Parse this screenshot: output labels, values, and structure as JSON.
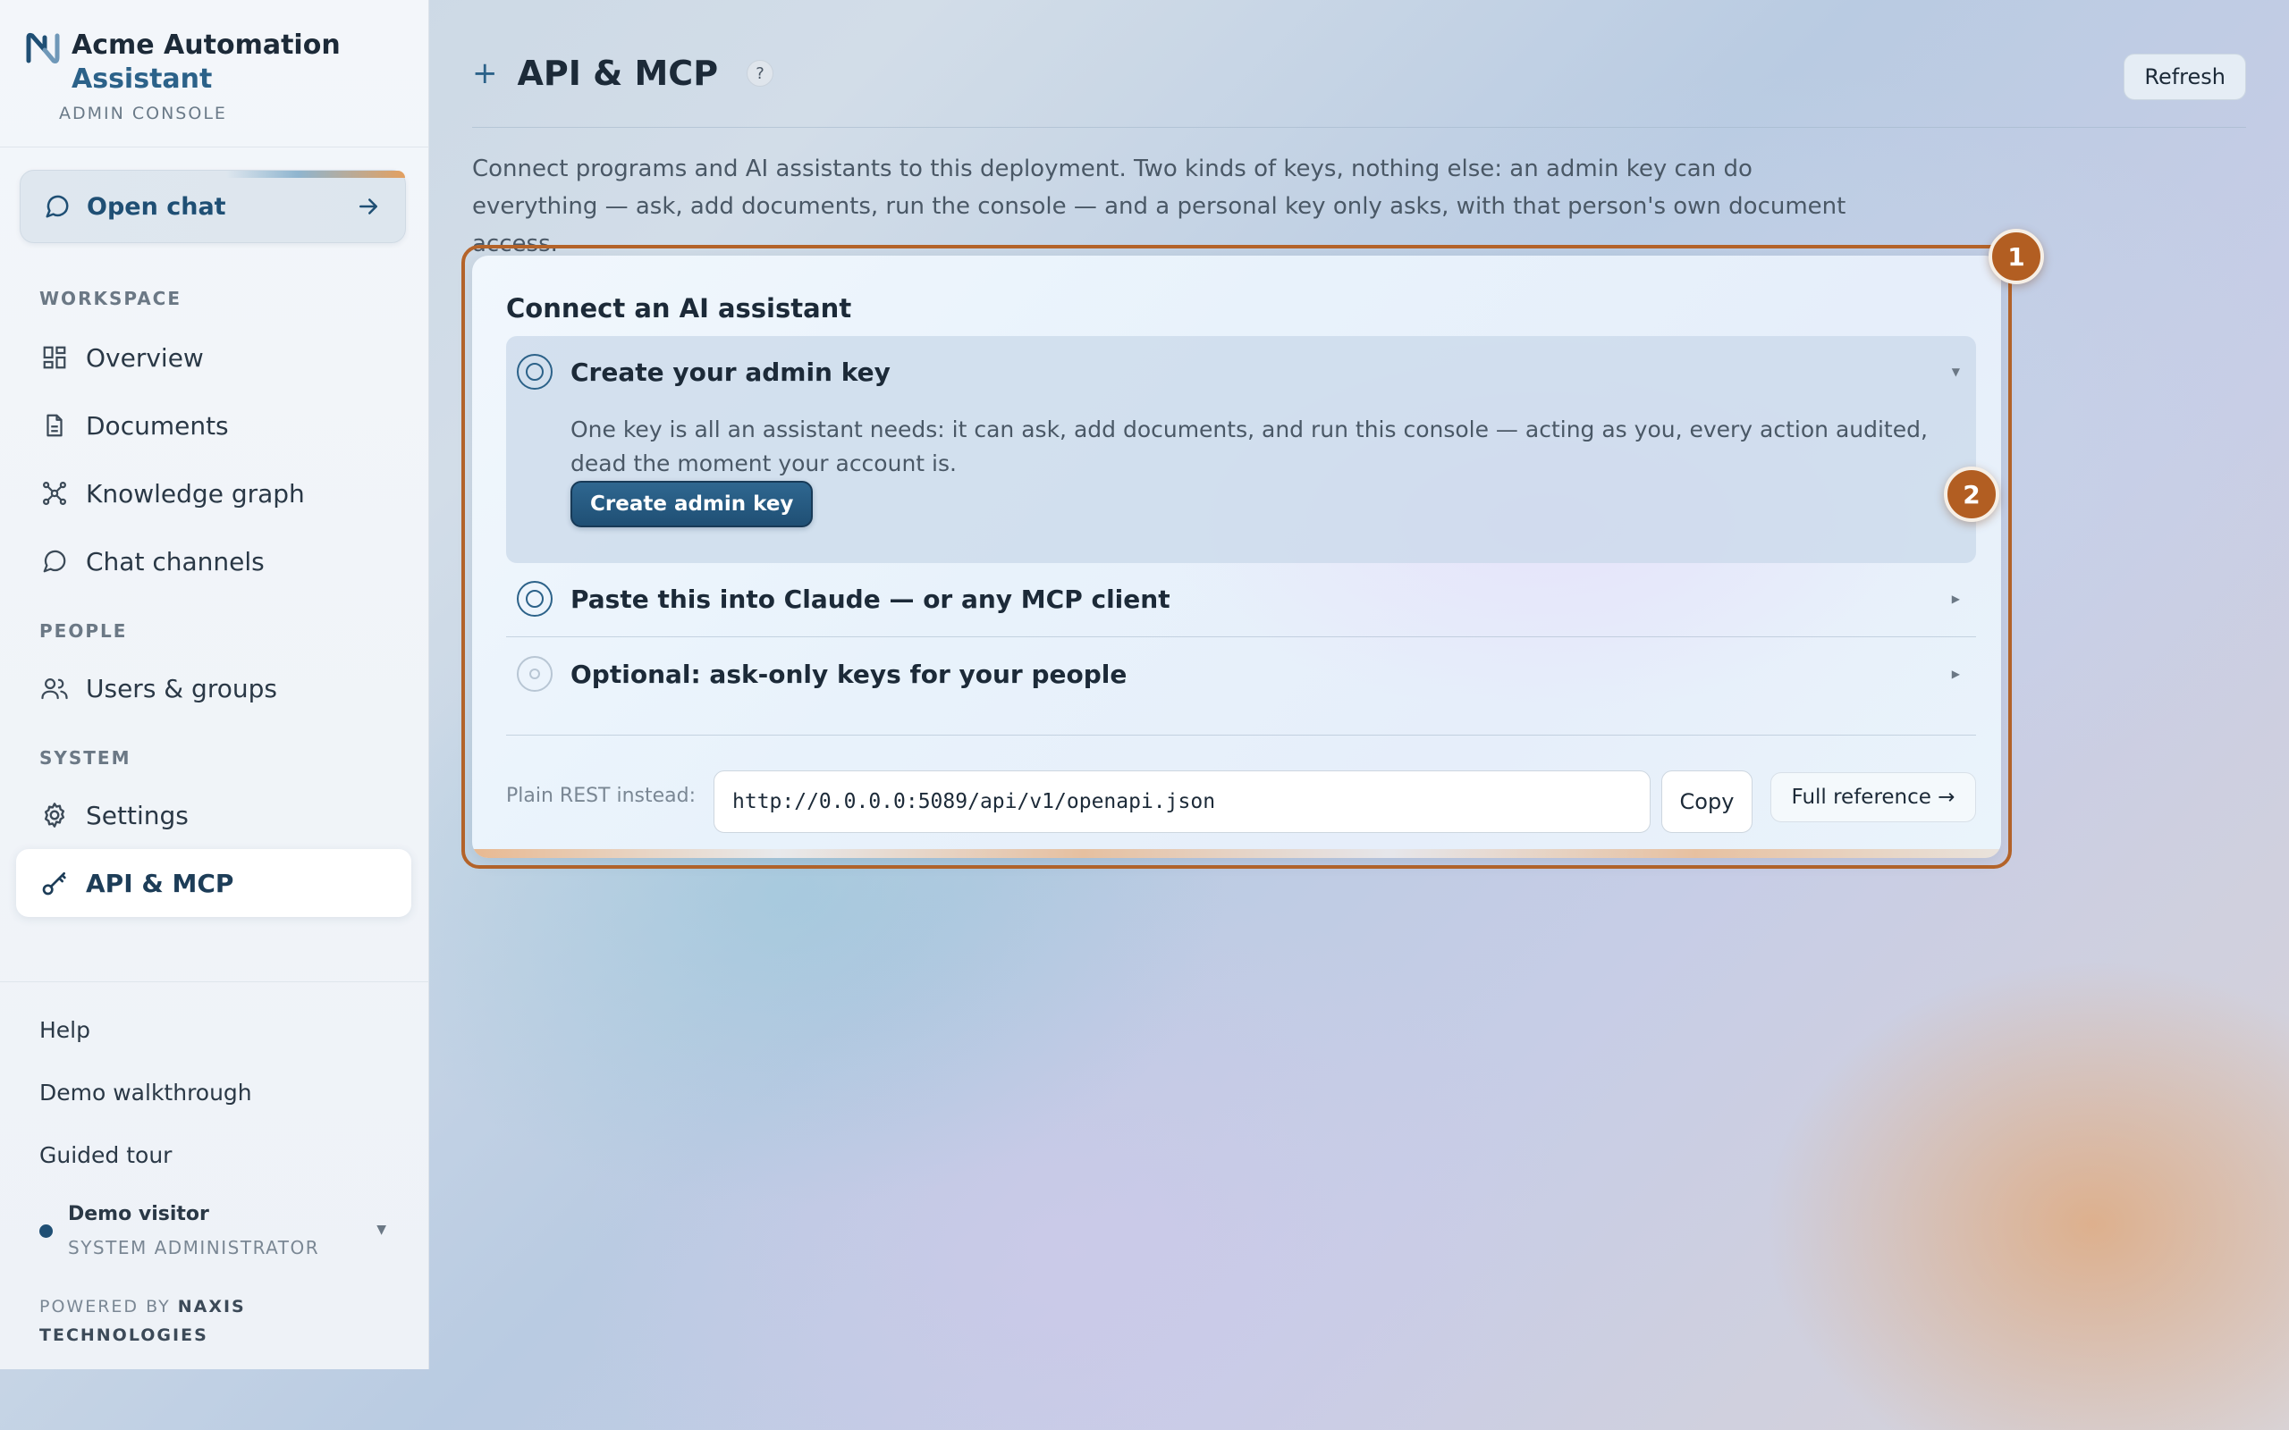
{
  "brand": {
    "line1": "Acme Automation",
    "line2": "Assistant",
    "subtitle": "ADMIN CONSOLE"
  },
  "sidebar": {
    "open_chat": "Open chat",
    "sections": {
      "workspace": "WORKSPACE",
      "people": "PEOPLE",
      "system": "SYSTEM"
    },
    "items": [
      {
        "label": "Overview",
        "icon": "grid-icon"
      },
      {
        "label": "Documents",
        "icon": "document-icon"
      },
      {
        "label": "Knowledge graph",
        "icon": "graph-icon"
      },
      {
        "label": "Chat channels",
        "icon": "chat-bubble-icon"
      },
      {
        "label": "Users & groups",
        "icon": "users-icon"
      },
      {
        "label": "Settings",
        "icon": "gear-icon"
      },
      {
        "label": "API & MCP",
        "icon": "key-icon",
        "active": true
      }
    ],
    "bottom": {
      "help": "Help",
      "demo": "Demo walkthrough",
      "tour": "Guided tour"
    },
    "user": {
      "name": "Demo visitor",
      "role": "SYSTEM ADMINISTRATOR"
    },
    "powered_by": "POWERED BY",
    "powered_company": "NAXIS TECHNOLOGIES"
  },
  "header": {
    "title": "API & MCP",
    "help": "?",
    "refresh": "Refresh",
    "description": "Connect programs and AI assistants to this deployment. Two kinds of keys, nothing else: an admin key can do everything — ask, add documents, run the console — and a personal key only asks, with that person's own document access."
  },
  "card": {
    "title": "Connect an AI assistant",
    "steps": [
      {
        "title": "Create your admin key",
        "expanded": true,
        "body": "One key is all an assistant needs: it can ask, add documents, and run this console — acting as you, every action audited, dead the moment your account is.",
        "button": "Create admin key"
      },
      {
        "title": "Paste this into Claude — or any MCP client",
        "expanded": false
      },
      {
        "title": "Optional: ask-only keys for your people",
        "expanded": false
      }
    ],
    "rest": {
      "label": "Plain REST instead:",
      "url": "http://0.0.0.0:5089/api/v1/openapi.json",
      "copy": "Copy",
      "reference": "Full reference →"
    }
  },
  "tour_badges": [
    "1",
    "2"
  ],
  "colors": {
    "accent": "#2c6289",
    "highlight": "#b5642a"
  }
}
